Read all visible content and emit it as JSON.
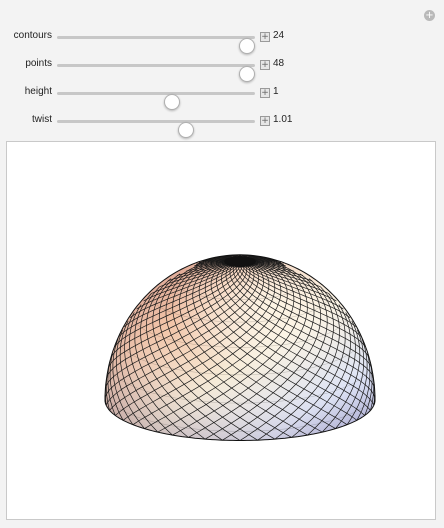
{
  "controls": [
    {
      "id": "contours",
      "label": "contours",
      "value": "24",
      "position": 0.96
    },
    {
      "id": "points",
      "label": "points",
      "value": "48",
      "position": 0.96
    },
    {
      "id": "height",
      "label": "height",
      "value": "1",
      "position": 0.58
    },
    {
      "id": "twist",
      "label": "twist",
      "value": "1.01",
      "position": 0.65
    }
  ],
  "icons": {
    "corner": "plus-circle-icon",
    "slider_expand": "plus-box-icon"
  },
  "plot": {
    "surface": "hemisphere",
    "contours": 24,
    "points": 48,
    "height": 1,
    "twist": 1.01,
    "colors": [
      "#ffe9c9",
      "#f4b8a0",
      "#c9a0b2",
      "#b7b8e0",
      "#eef4ff"
    ]
  }
}
